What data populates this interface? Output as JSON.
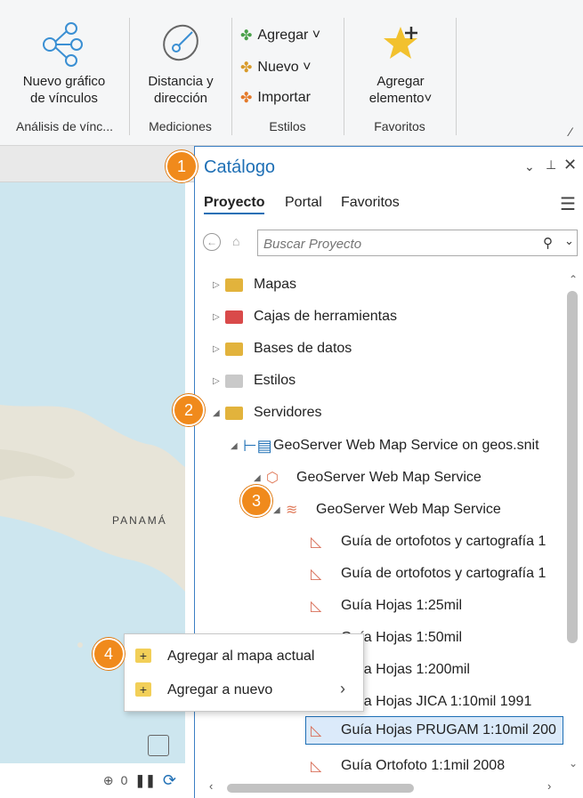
{
  "ribbon": {
    "new_graph_label": "Nuevo gráfico\nde vínculos",
    "distance_label": "Distancia y\ndirección",
    "styles_add": "Agregar ˅",
    "styles_new": "Nuevo ˅",
    "styles_import": "Importar",
    "fav_add_label": "Agregar\nelemento˅",
    "groups": [
      "Análisis de vínc...",
      "Mediciones",
      "Estilos",
      "Favoritos"
    ]
  },
  "catalog": {
    "title": "Catálogo",
    "tabs": [
      "Proyecto",
      "Portal",
      "Favoritos"
    ],
    "search_placeholder": "Buscar Proyecto",
    "tree": [
      {
        "label": "Mapas"
      },
      {
        "label": "Cajas de herramientas"
      },
      {
        "label": "Bases de datos"
      },
      {
        "label": "Estilos"
      },
      {
        "label": "Servidores"
      },
      {
        "label": "GeoServer Web Map Service on geos.snit"
      },
      {
        "label": "GeoServer Web Map Service"
      },
      {
        "label": "GeoServer Web Map Service"
      },
      {
        "label": "Guía de ortofotos y cartografía 1"
      },
      {
        "label": "Guía de ortofotos y cartografía 1"
      },
      {
        "label": "Guía Hojas 1:25mil"
      },
      {
        "label": "Guía Hojas 1:50mil"
      },
      {
        "label": "Guía Hojas 1:200mil"
      },
      {
        "label": "Guía Hojas JICA 1:10mil 1991"
      },
      {
        "label": "Guía Hojas PRUGAM 1:10mil 200"
      },
      {
        "label": "Guía Ortofoto 1:1mil 2008"
      }
    ]
  },
  "map": {
    "country_label": "PANAMÁ",
    "count": "0"
  },
  "context_menu": {
    "items": [
      "Agregar al mapa actual",
      "Agregar a nuevo"
    ]
  },
  "badges": [
    "1",
    "2",
    "3",
    "4"
  ],
  "colors": {
    "accent": "#1e6fb5",
    "badge": "#f08a1c",
    "selection": "#dbeafa"
  }
}
